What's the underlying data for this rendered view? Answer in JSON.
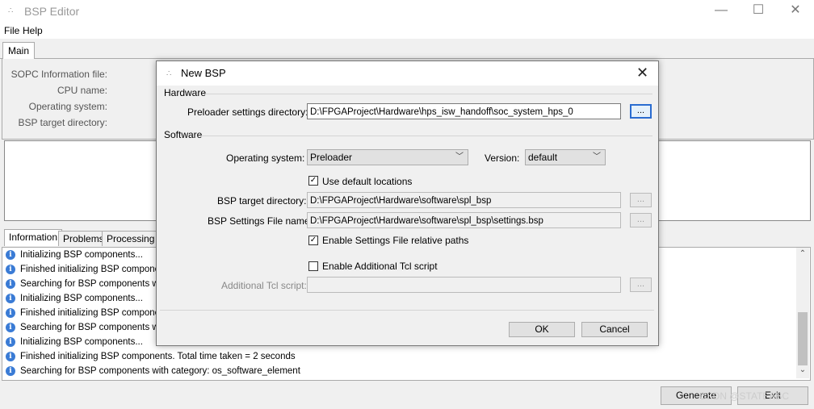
{
  "window": {
    "title": "BSP Editor",
    "controls": {
      "minimize": "—",
      "maximize": "☐",
      "close": "✕"
    }
  },
  "menu": [
    "File",
    "Help"
  ],
  "main_tab": "Main",
  "main_fields": {
    "sopc": "SOPC Information file:",
    "cpu": "CPU name:",
    "os": "Operating system:",
    "bsp_dir": "BSP target directory:"
  },
  "info_tabs": [
    "Information",
    "Problems",
    "Processing"
  ],
  "log": [
    "Initializing BSP components...",
    "Finished initializing BSP components",
    "Searching for BSP components with",
    "Initializing BSP components...",
    "Finished initializing BSP components",
    "Searching for BSP components with",
    "Initializing BSP components...",
    "Finished initializing BSP components. Total time taken = 2 seconds",
    "Searching for BSP components with category: os_software_element"
  ],
  "bottom_buttons": {
    "generate": "Generate",
    "exit": "Exit"
  },
  "watermark": "CSDN @STATEABC",
  "dialog": {
    "title": "New BSP",
    "close": "✕",
    "hardware": {
      "group": "Hardware",
      "preloader_label": "Preloader settings directory:",
      "preloader_value": "D:\\FPGAProject\\Hardware\\hps_isw_handoff\\soc_system_hps_0",
      "browse": "..."
    },
    "software": {
      "group": "Software",
      "os_label": "Operating system:",
      "os_value": "Preloader",
      "version_label": "Version:",
      "version_value": "default",
      "use_default_label": "Use default locations",
      "use_default_checked": true,
      "bsp_dir_label": "BSP target directory:",
      "bsp_dir_value": "D:\\FPGAProject\\Hardware\\software\\spl_bsp",
      "settings_label": "BSP Settings File name:",
      "settings_value": "D:\\FPGAProject\\Hardware\\software\\spl_bsp\\settings.bsp",
      "relative_label": "Enable Settings File relative paths",
      "relative_checked": true,
      "tcl_enable_label": "Enable Additional Tcl script",
      "tcl_enable_checked": false,
      "tcl_label": "Additional Tcl script:",
      "tcl_value": "",
      "browse": "..."
    },
    "ok": "OK",
    "cancel": "Cancel"
  },
  "icons": {
    "app": "dots-icon",
    "info": "info-icon"
  }
}
